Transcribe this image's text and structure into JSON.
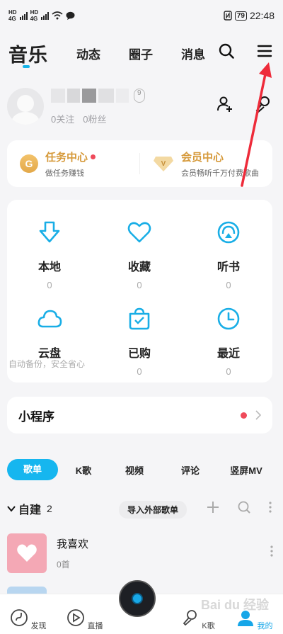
{
  "status_bar": {
    "network_labels": [
      "HD",
      "4G",
      "HD",
      "4G"
    ],
    "battery": "79",
    "time": "22:48"
  },
  "top_nav": {
    "tabs": [
      {
        "label": "音乐",
        "active": true
      },
      {
        "label": "动态",
        "active": false
      },
      {
        "label": "圈子",
        "active": false
      },
      {
        "label": "消息",
        "active": false
      }
    ],
    "icons": [
      "search-icon",
      "menu-icon"
    ],
    "accent": "#18b4e8"
  },
  "profile": {
    "level": "9",
    "following": "0关注",
    "followers": "0粉丝"
  },
  "vip": {
    "task": {
      "title": "任务中心",
      "subtitle": "做任务赚钱",
      "icon_text": "G"
    },
    "member": {
      "title": "会员中心",
      "subtitle": "会员畅听千万付费歌曲",
      "icon_text": "V"
    }
  },
  "grid": [
    {
      "label": "本地",
      "count": "0",
      "icon": "download-icon"
    },
    {
      "label": "收藏",
      "count": "0",
      "icon": "heart-icon"
    },
    {
      "label": "听书",
      "count": "0",
      "icon": "audiobook-icon"
    },
    {
      "label": "云盘",
      "count": "",
      "icon": "cloud-icon"
    },
    {
      "label": "已购",
      "count": "0",
      "icon": "purchased-bag-icon"
    },
    {
      "label": "最近",
      "count": "0",
      "icon": "clock-icon"
    }
  ],
  "grid_note": "自动备份，安全省心",
  "mini_programs": {
    "title": "小程序"
  },
  "content_tabs": [
    {
      "label": "歌单",
      "active": true
    },
    {
      "label": "K歌",
      "active": false
    },
    {
      "label": "视频",
      "active": false
    },
    {
      "label": "评论",
      "active": false
    },
    {
      "label": "竖屏MV",
      "active": false
    }
  ],
  "self_built": {
    "title": "自建",
    "count": "2",
    "import_label": "导入外部歌单"
  },
  "playlist": {
    "name": "我喜欢",
    "count": "0首"
  },
  "bottom_nav": [
    {
      "label": "发现",
      "icon": "discover-icon"
    },
    {
      "label": "直播",
      "icon": "live-icon"
    },
    {
      "label": "",
      "icon": "player-disc-icon"
    },
    {
      "label": "K歌",
      "icon": "mic-icon"
    },
    {
      "label": "我的",
      "icon": "profile-icon",
      "active": true
    }
  ],
  "watermark": "Bai du 经验"
}
